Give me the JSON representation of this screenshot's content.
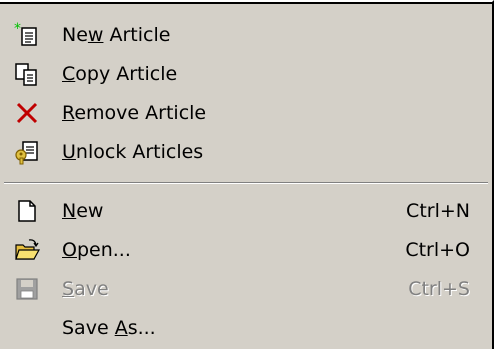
{
  "menu": {
    "items": [
      {
        "label": "New Article",
        "underline_char": "w",
        "underline_index": 2,
        "shortcut": "",
        "icon": "new-article-icon",
        "enabled": true
      },
      {
        "label": "Copy Article",
        "underline_char": "C",
        "underline_index": 0,
        "shortcut": "",
        "icon": "copy-article-icon",
        "enabled": true
      },
      {
        "label": "Remove Article",
        "underline_char": "R",
        "underline_index": 0,
        "shortcut": "",
        "icon": "remove-article-icon",
        "enabled": true
      },
      {
        "label": "Unlock Articles",
        "underline_char": "U",
        "underline_index": 0,
        "shortcut": "",
        "icon": "unlock-articles-icon",
        "enabled": true
      },
      {
        "label": "New",
        "underline_char": "N",
        "underline_index": 0,
        "shortcut": "Ctrl+N",
        "icon": "new-document-icon",
        "enabled": true
      },
      {
        "label": "Open...",
        "underline_char": "O",
        "underline_index": 0,
        "shortcut": "Ctrl+O",
        "icon": "open-folder-icon",
        "enabled": true
      },
      {
        "label": "Save",
        "underline_char": "S",
        "underline_index": 0,
        "shortcut": "Ctrl+S",
        "icon": "save-disk-icon",
        "enabled": false
      },
      {
        "label": "Save As...",
        "underline_char": "A",
        "underline_index": 5,
        "shortcut": "",
        "icon": "",
        "enabled": true
      }
    ]
  },
  "colors": {
    "menu_background": "#d4d0c8",
    "disabled_text": "#808080",
    "remove_icon": "#c00000",
    "new_star": "#00c000"
  }
}
